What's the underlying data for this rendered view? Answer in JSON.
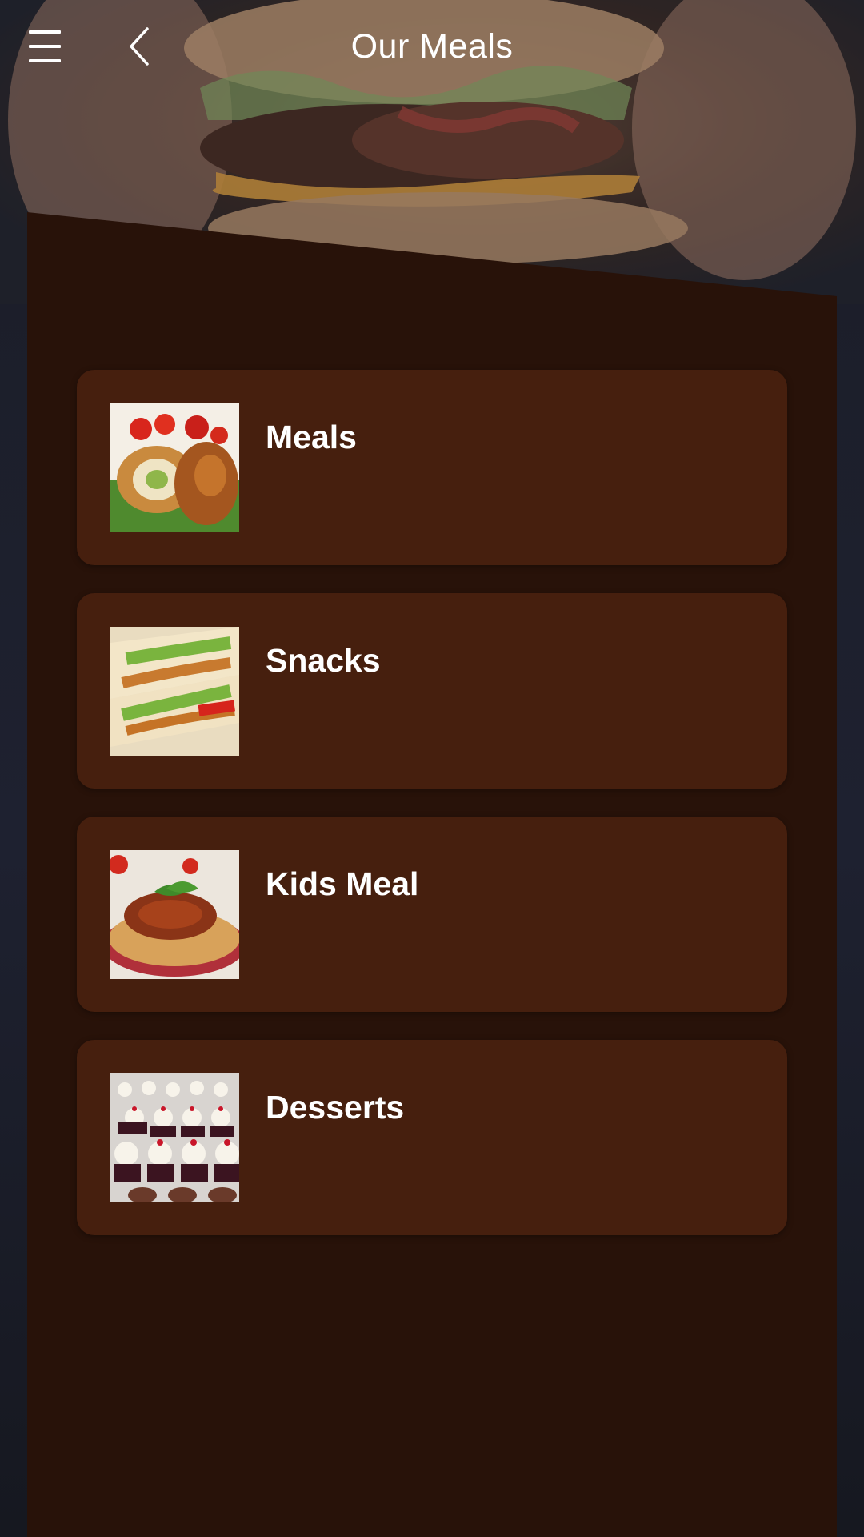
{
  "header": {
    "title": "Our Meals",
    "menu_icon": "hamburger-menu-icon",
    "back_icon": "chevron-left-icon"
  },
  "hero": {
    "image": "burger-photo"
  },
  "categories": [
    {
      "label": "Meals",
      "image": "stuffed-chicken-rolls-photo"
    },
    {
      "label": "Snacks",
      "image": "chicken-wraps-photo"
    },
    {
      "label": "Kids Meal",
      "image": "spaghetti-bolognese-photo"
    },
    {
      "label": "Desserts",
      "image": "cupcakes-photo"
    }
  ],
  "colors": {
    "panel_background": "#281209",
    "card_background": "#461f0e",
    "text": "#ffffff",
    "page_background": "#1b1d27"
  }
}
